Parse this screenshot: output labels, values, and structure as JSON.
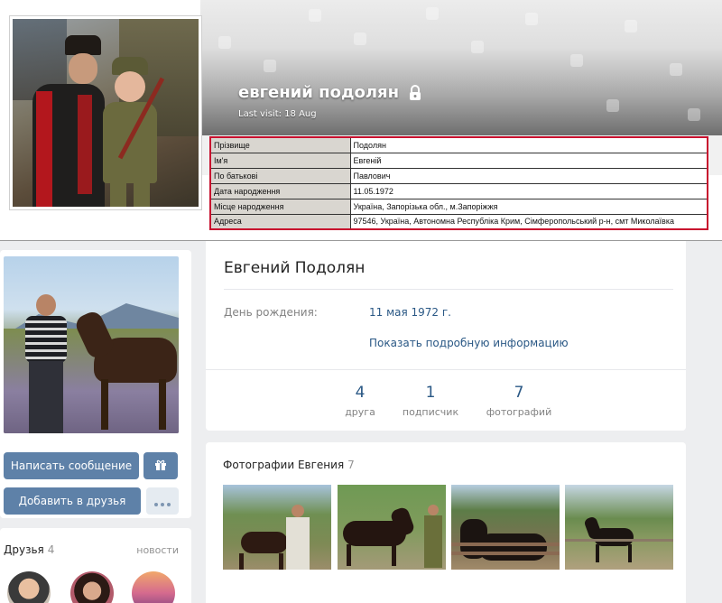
{
  "top_profile": {
    "name": "евгений подолян",
    "last_visit": "Last visit: 18 Aug",
    "lock_icon": "lock-icon",
    "info_rows": [
      {
        "label": "Прізвище",
        "value": "Подолян"
      },
      {
        "label": "Ім'я",
        "value": "Евгеній"
      },
      {
        "label": "По батькові",
        "value": "Павлович"
      },
      {
        "label": "Дата народження",
        "value": "11.05.1972"
      },
      {
        "label": "Місце народження",
        "value": "Україна, Запорізька обл., м.Запоріжжя"
      },
      {
        "label": "Адреса",
        "value": "97546, Україна, Автономна Республіка Крим, Сімферопольський р-н, смт Миколаївка"
      }
    ],
    "highlight_color": "#c8102e"
  },
  "profile": {
    "name": "Евгений Подолян",
    "birthday_label": "День рождения:",
    "birthday_value": "11 мая 1972 г.",
    "more_info_link": "Показать подробную информацию",
    "counters": [
      {
        "value": "4",
        "label": "друга"
      },
      {
        "value": "1",
        "label": "подписчик"
      },
      {
        "value": "7",
        "label": "фотографий"
      }
    ]
  },
  "actions": {
    "message_button": "Написать сообщение",
    "add_friend_button": "Добавить в друзья",
    "gift_icon": "gift-icon",
    "more_icon": "more-icon"
  },
  "friends": {
    "title": "Друзья",
    "count": "4",
    "news_link": "новости"
  },
  "photos": {
    "title": "Фотографии Евгения",
    "count": "7"
  },
  "colors": {
    "vk_button": "#5e81a8",
    "vk_link": "#2a5885",
    "page_bg": "#edeef0"
  }
}
